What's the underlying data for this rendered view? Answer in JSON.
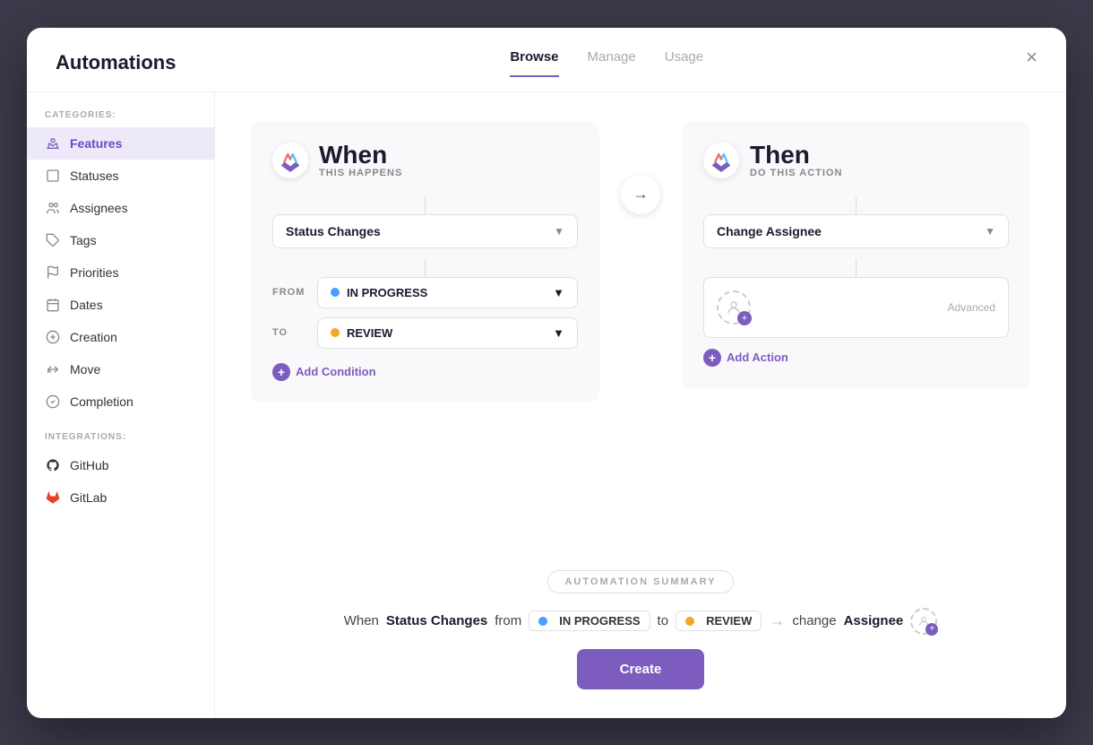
{
  "modal": {
    "title": "Automations",
    "close_label": "×"
  },
  "tabs": [
    {
      "id": "browse",
      "label": "Browse",
      "active": true
    },
    {
      "id": "manage",
      "label": "Manage",
      "active": false
    },
    {
      "id": "usage",
      "label": "Usage",
      "active": false
    }
  ],
  "sidebar": {
    "categories_label": "CATEGORIES:",
    "integrations_label": "INTEGRATIONS:",
    "categories": [
      {
        "id": "features",
        "label": "Features",
        "active": true,
        "icon": "crown"
      },
      {
        "id": "statuses",
        "label": "Statuses",
        "active": false,
        "icon": "square"
      },
      {
        "id": "assignees",
        "label": "Assignees",
        "active": false,
        "icon": "people"
      },
      {
        "id": "tags",
        "label": "Tags",
        "active": false,
        "icon": "tag"
      },
      {
        "id": "priorities",
        "label": "Priorities",
        "active": false,
        "icon": "flag"
      },
      {
        "id": "dates",
        "label": "Dates",
        "active": false,
        "icon": "calendar"
      },
      {
        "id": "creation",
        "label": "Creation",
        "active": false,
        "icon": "plus-circle"
      },
      {
        "id": "move",
        "label": "Move",
        "active": false,
        "icon": "move"
      },
      {
        "id": "completion",
        "label": "Completion",
        "active": false,
        "icon": "check-circle"
      }
    ],
    "integrations": [
      {
        "id": "github",
        "label": "GitHub",
        "icon": "github"
      },
      {
        "id": "gitlab",
        "label": "GitLab",
        "icon": "gitlab"
      }
    ]
  },
  "when_block": {
    "title": "When",
    "subtitle": "THIS HAPPENS",
    "trigger_label": "Status Changes",
    "from_label": "FROM",
    "from_status": "IN PROGRESS",
    "from_color": "blue",
    "to_label": "TO",
    "to_status": "REVIEW",
    "to_color": "yellow",
    "add_condition_label": "Add Condition"
  },
  "then_block": {
    "title": "Then",
    "subtitle": "DO THIS ACTION",
    "action_label": "Change Assignee",
    "advanced_label": "Advanced",
    "add_action_label": "Add Action"
  },
  "summary": {
    "section_label": "AUTOMATION SUMMARY",
    "text_when": "When",
    "text_status_changes": "Status Changes",
    "text_from": "from",
    "text_in_progress": "IN PROGRESS",
    "text_to": "to",
    "text_review": "REVIEW",
    "text_change": "change",
    "text_assignee": "Assignee",
    "create_label": "Create"
  }
}
